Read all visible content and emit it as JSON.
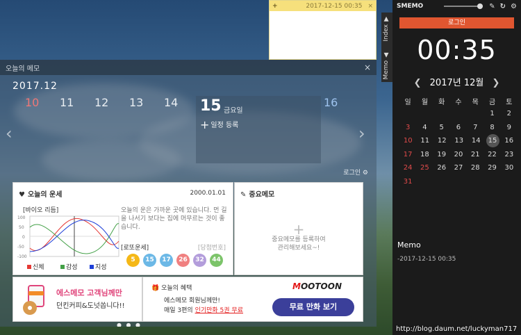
{
  "sticky": {
    "add_label": "+",
    "timestamp": "2017-12-15 00:35",
    "close_label": "×"
  },
  "memo_window": {
    "title": "오늘의 메모",
    "close_label": "×",
    "year_month": "2017.12",
    "days": [
      "10",
      "11",
      "12",
      "13",
      "14",
      "15",
      "16"
    ],
    "today": {
      "day": "15",
      "dow": "금요일",
      "add_label": "일정 등록"
    },
    "login_label": "로그인",
    "prev_arrow": "‹",
    "next_arrow": "›"
  },
  "fortune": {
    "title": "오늘의 운세",
    "date": "2000.01.01",
    "bio_label": "[바이오 리듬]",
    "text": "오늘의 운은 가까운 곳에 있습니다. 먼 길을 나서기 보다는 집에 머무르는 것이 좋습니다.",
    "lotto_label": "[로또운세]",
    "draw_label": "[당첨번호]",
    "lotto_numbers": [
      "5",
      "15",
      "17",
      "26",
      "32",
      "44"
    ],
    "lotto_colors": [
      "#f5b817",
      "#6cb8e6",
      "#6cb8e6",
      "#f08080",
      "#b39ddb",
      "#7cc46a"
    ],
    "legend": [
      {
        "label": "신체",
        "color": "#e53935"
      },
      {
        "label": "감성",
        "color": "#43a047"
      },
      {
        "label": "지성",
        "color": "#1e3fd8"
      }
    ],
    "y_ticks": [
      "100",
      "50",
      "0",
      "-50",
      "-100"
    ]
  },
  "important": {
    "title": "중요메모",
    "empty_plus": "+",
    "empty_text_1": "중요메모를 등록하여",
    "empty_text_2": "관리해보세요~!"
  },
  "ad1": {
    "line1": "에스메모 고객님께만",
    "line2": "던킨커피&도넛쏩니다!!"
  },
  "ad2": {
    "title": "오늘의 혜택",
    "line1": "에스메모 회원님께만!",
    "line2_pre": "매일 3편의 ",
    "line2_red": "인기만화 5권 무료",
    "brand_m": "M",
    "brand_rest": "OOTOON",
    "button": "무료 만화 보기"
  },
  "sidebar": {
    "app_name": "SMEMO",
    "tab_index": "Index ▼",
    "tab_memo": "Memo ▲",
    "login_button": "로그인",
    "clock": "00:35",
    "cal_title": "2017년 12월",
    "prev": "❮",
    "next": "❯",
    "dows": [
      "일",
      "월",
      "화",
      "수",
      "목",
      "금",
      "토"
    ],
    "weeks": [
      [
        "",
        "",
        "",
        "",
        "",
        "1",
        "2"
      ],
      [
        "3",
        "4",
        "5",
        "6",
        "7",
        "8",
        "9"
      ],
      [
        "10",
        "11",
        "12",
        "13",
        "14",
        "15",
        "16"
      ],
      [
        "17",
        "18",
        "19",
        "20",
        "21",
        "22",
        "23"
      ],
      [
        "24",
        "25",
        "26",
        "27",
        "28",
        "29",
        "30"
      ],
      [
        "31",
        "",
        "",
        "",
        "",
        "",
        ""
      ]
    ],
    "memo_heading": "Memo",
    "memo_item": "-2017-12-15 00:35"
  },
  "watermark": "http://blog.daum.net/luckyman717",
  "colors": {
    "accent": "#e05630",
    "sunday": "#e24b4b",
    "button": "#3b3f9a"
  }
}
